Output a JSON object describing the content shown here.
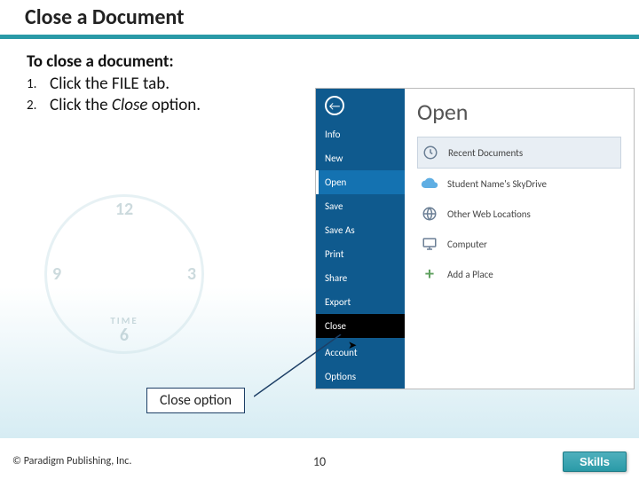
{
  "title": "Close a Document",
  "instructions": {
    "intro": "To close a document:",
    "steps": [
      {
        "num": "1.",
        "text_before": "Click the FILE tab."
      },
      {
        "num": "2.",
        "text_before": "Click the ",
        "em": "Close",
        "text_after": " option."
      }
    ]
  },
  "callout": "Close option",
  "backstage": {
    "left": {
      "items_top": [
        "Info",
        "New",
        "Open",
        "Save",
        "Save As",
        "Print",
        "Share",
        "Export",
        "Close"
      ],
      "items_bottom": [
        "Account",
        "Options"
      ],
      "selected": "Open",
      "close_highlight": "Close"
    },
    "right": {
      "heading": "Open",
      "items": [
        {
          "icon": "recent",
          "label": "Recent Documents",
          "selected": true
        },
        {
          "icon": "skydrive",
          "label": "Student Name's SkyDrive"
        },
        {
          "icon": "web",
          "label": "Other Web Locations"
        },
        {
          "icon": "computer",
          "label": "Computer"
        },
        {
          "icon": "add",
          "label": "Add a Place"
        }
      ]
    }
  },
  "footer": {
    "copyright": "© Paradigm Publishing, Inc.",
    "page": "10",
    "skills": "Skills"
  },
  "clock": {
    "t12": "12",
    "t3": "3",
    "t6": "6",
    "t9": "9",
    "time": "TIME"
  }
}
